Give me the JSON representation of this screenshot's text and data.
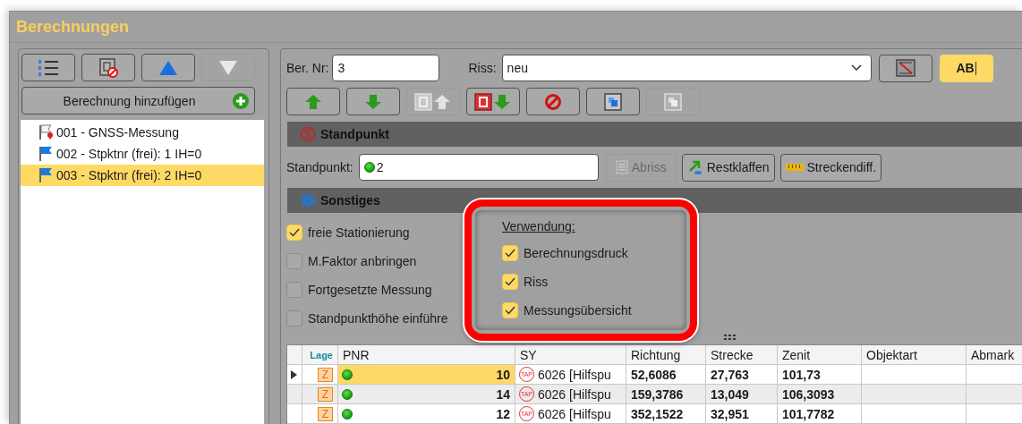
{
  "window": {
    "title": "Berechnungen"
  },
  "left_panel": {
    "toolbar": [
      {
        "kind": "numbered-list",
        "disabled": false
      },
      {
        "kind": "delete-doc",
        "disabled": false
      },
      {
        "kind": "up",
        "disabled": false
      },
      {
        "kind": "down",
        "disabled": true
      }
    ],
    "add_button": {
      "label": "Berechnung hinzufügen"
    },
    "items": [
      {
        "kind": "gnss",
        "label": "001 - GNSS-Messung",
        "selected": false
      },
      {
        "kind": "station",
        "label": "002 - Stpktnr (frei): 1 IH=0",
        "selected": false
      },
      {
        "kind": "station",
        "label": "003 - Stpktnr (frei): 2 IH=0",
        "selected": true
      }
    ]
  },
  "form": {
    "ber_nr": {
      "label": "Ber. Nr:",
      "value": "3"
    },
    "riss": {
      "label": "Riss:",
      "value": "neu"
    },
    "draw_button": {
      "disabled": false
    },
    "text_button": {
      "label": "AB",
      "on": true
    },
    "toolbar": [
      {
        "kind": "arrow-up",
        "disabled": false
      },
      {
        "kind": "arrow-down",
        "disabled": false
      },
      {
        "kind": "box-up",
        "disabled": true
      },
      {
        "kind": "box-down",
        "disabled": false
      },
      {
        "kind": "prohibit",
        "disabled": false
      },
      {
        "kind": "copy",
        "disabled": false
      },
      {
        "kind": "copy",
        "disabled": true
      }
    ]
  },
  "standpunkt_section": {
    "title": "Standpunkt",
    "label": "Standpunkt:",
    "value": "2",
    "buttons": [
      {
        "kind": "list",
        "label": "Abriss",
        "disabled": true
      },
      {
        "kind": "arrow",
        "label": "Restklaffen",
        "disabled": false
      },
      {
        "kind": "ruler",
        "label": "Streckendiff.",
        "disabled": false
      }
    ]
  },
  "sonstiges_section": {
    "title": "Sonstiges",
    "options": [
      {
        "label": "freie Stationierung",
        "checked": true
      },
      {
        "label": "M.Faktor anbringen",
        "checked": false
      },
      {
        "label": "Fortgesetzte Messung",
        "checked": false
      },
      {
        "label": "Standpunkthöhe einführe",
        "checked": false
      }
    ]
  },
  "usage_panel": {
    "heading": "Verwendung:",
    "options": [
      {
        "label": "Berechnungsdruck",
        "checked": true
      },
      {
        "label": "Riss",
        "checked": true
      },
      {
        "label": "Messungsübersicht",
        "checked": true
      }
    ]
  },
  "table": {
    "columns": [
      "Lage",
      "PNR",
      "SY",
      "Richtung",
      "Strecke",
      "Zenit",
      "Objektart",
      "Abmark"
    ],
    "rows": [
      {
        "current": true,
        "selected": true,
        "lage": "Z",
        "pnr": "10",
        "sy_symbol": "TAP",
        "sy": "6026 [Hilfspu",
        "richtung": "52,6086",
        "strecke": "27,763",
        "zenit": "101,73"
      },
      {
        "current": false,
        "selected": false,
        "lage": "Z",
        "pnr": "14",
        "sy_symbol": "TAP",
        "sy": "6026 [Hilfspu",
        "richtung": "159,3786",
        "strecke": "13,049",
        "zenit": "106,3093"
      },
      {
        "current": false,
        "selected": false,
        "lage": "Z",
        "pnr": "12",
        "sy_symbol": "TAP",
        "sy": "6026 [Hilfspu",
        "richtung": "352,1522",
        "strecke": "32,951",
        "zenit": "101,7782"
      }
    ]
  }
}
